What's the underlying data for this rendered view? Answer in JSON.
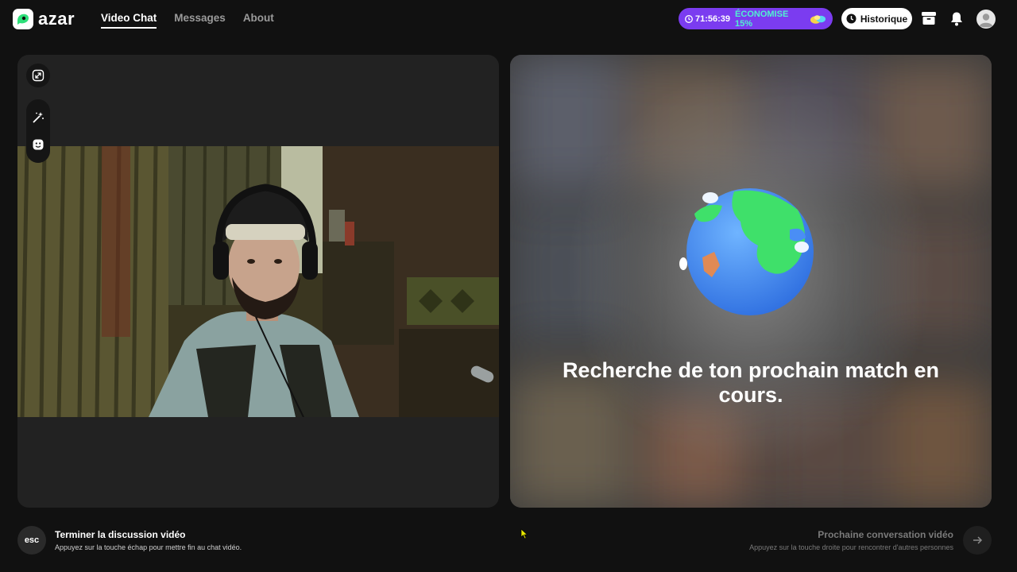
{
  "header": {
    "logo_text": "azar",
    "nav": [
      {
        "label": "Video Chat",
        "active": true
      },
      {
        "label": "Messages",
        "active": false
      },
      {
        "label": "About",
        "active": false
      }
    ],
    "promo": {
      "timer": "71:56:39",
      "offer": "ÉCONOMISE 15%"
    },
    "history_label": "Historique",
    "icons": [
      "store-icon",
      "bell-icon",
      "avatar-icon"
    ]
  },
  "left_panel": {
    "tools": [
      "expand-icon",
      "magic-wand-icon",
      "face-filter-icon"
    ]
  },
  "right_panel": {
    "search_message": "Recherche de ton prochain match en cours."
  },
  "footer": {
    "esc_label": "esc",
    "end_title": "Terminer la discussion vidéo",
    "end_hint": "Appuyez sur la touche échap pour mettre fin au chat vidéo.",
    "next_title": "Prochaine conversation vidéo",
    "next_hint": "Appuyez sur la touche droite pour rencontrer d'autres personnes"
  },
  "colors": {
    "background": "#111111",
    "promo": "#7b3cf0",
    "promo_accent": "#51f0d0",
    "brand_green": "#2ee07a"
  }
}
